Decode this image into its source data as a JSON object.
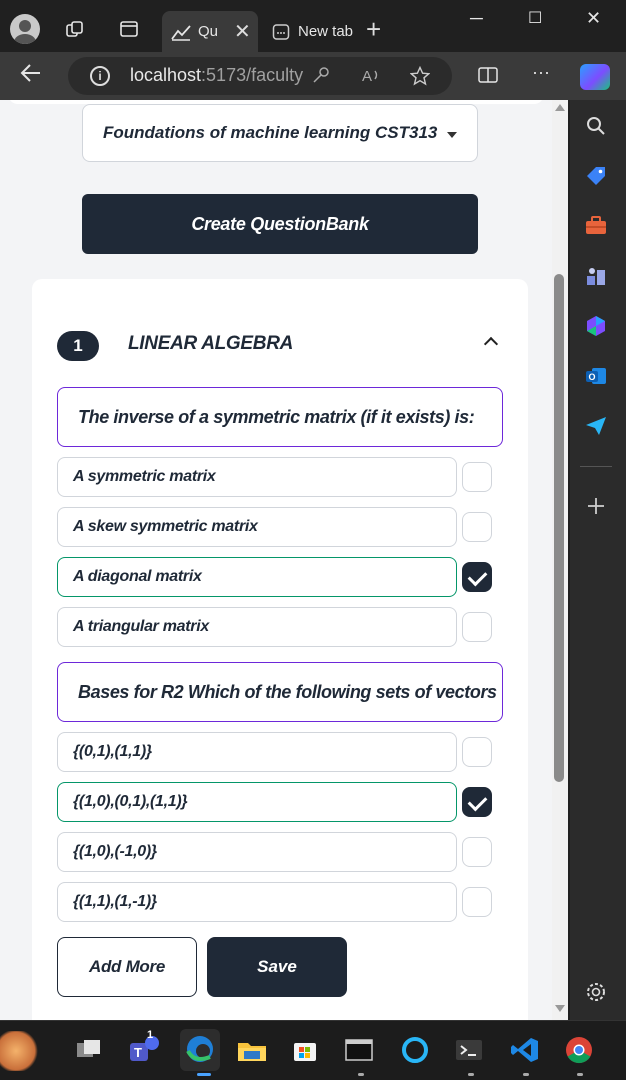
{
  "browser": {
    "active_tab_title": "Qu",
    "inactive_tab_title": "New tab",
    "url_host": "localhost",
    "url_path": ":5173/faculty",
    "new_tab_symbol": "+",
    "minimize_symbol": "─",
    "maximize_symbol": "☐",
    "close_symbol": "✕",
    "more_symbol": "···"
  },
  "page": {
    "course_select": "Foundations of machine learning CST313",
    "create_button": "Create QuestionBank",
    "section": {
      "number": "1",
      "title": "LINEAR ALGEBRA"
    },
    "questions": [
      {
        "text": "The inverse of a symmetric matrix (if it exists) is:",
        "options": [
          {
            "text": "A symmetric matrix",
            "checked": false
          },
          {
            "text": "A skew symmetric matrix",
            "checked": false
          },
          {
            "text": "A diagonal matrix",
            "checked": true
          },
          {
            "text": " A triangular matrix",
            "checked": false
          }
        ]
      },
      {
        "text": "Bases for R2 Which of the following sets of vectors",
        "options": [
          {
            "text": " {(0,1),(1,1)}",
            "checked": false
          },
          {
            "text": "{(1,0),(0,1),(1,1)}",
            "checked": true
          },
          {
            "text": " {(1,0),(-1,0)}",
            "checked": false
          },
          {
            "text": "{(1,1),(1,-1)}",
            "checked": false
          }
        ]
      }
    ],
    "add_more_button": "Add More",
    "save_button": "Save"
  },
  "colors": {
    "primary": "#1f2937",
    "question_border": "#6d28d9",
    "correct_border": "#059669"
  },
  "taskbar": {
    "teams_badge": "1"
  }
}
